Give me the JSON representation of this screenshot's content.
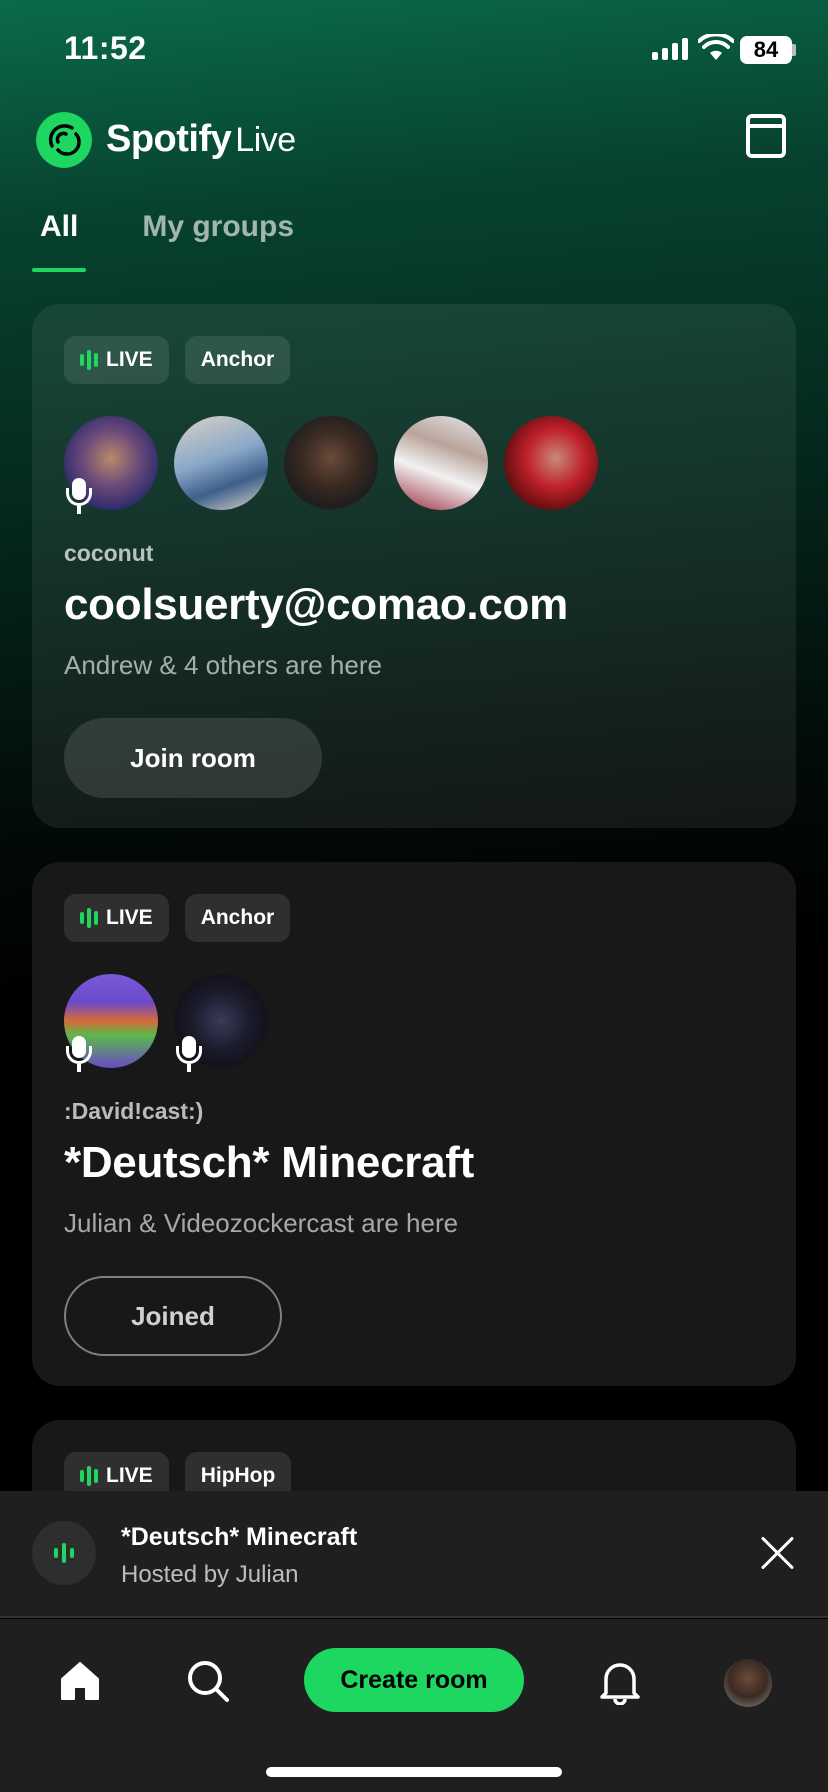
{
  "status_bar": {
    "time": "11:52",
    "battery": "84"
  },
  "header": {
    "brand": "Spotify",
    "brand_suffix": "Live"
  },
  "tabs": [
    {
      "label": "All"
    },
    {
      "label": "My groups"
    }
  ],
  "rooms": [
    {
      "tags": [
        "LIVE",
        "Anchor"
      ],
      "host": "coconut",
      "title": "coolsuerty@comao.com",
      "subtitle": "Andrew & 4 others are here",
      "button": "Join room"
    },
    {
      "tags": [
        "LIVE",
        "Anchor"
      ],
      "host": ":David!cast:)",
      "title": "*Deutsch* Minecraft",
      "subtitle": "Julian & Videozockercast are here",
      "button": "Joined"
    },
    {
      "tags": [
        "LIVE",
        "HipHop"
      ]
    }
  ],
  "mini_player": {
    "title": "*Deutsch* Minecraft",
    "subtitle": "Hosted by Julian"
  },
  "bottom_nav": {
    "create_label": "Create room"
  },
  "colors": {
    "accent": "#1ed760",
    "card": "#181818",
    "background": "#000000"
  }
}
